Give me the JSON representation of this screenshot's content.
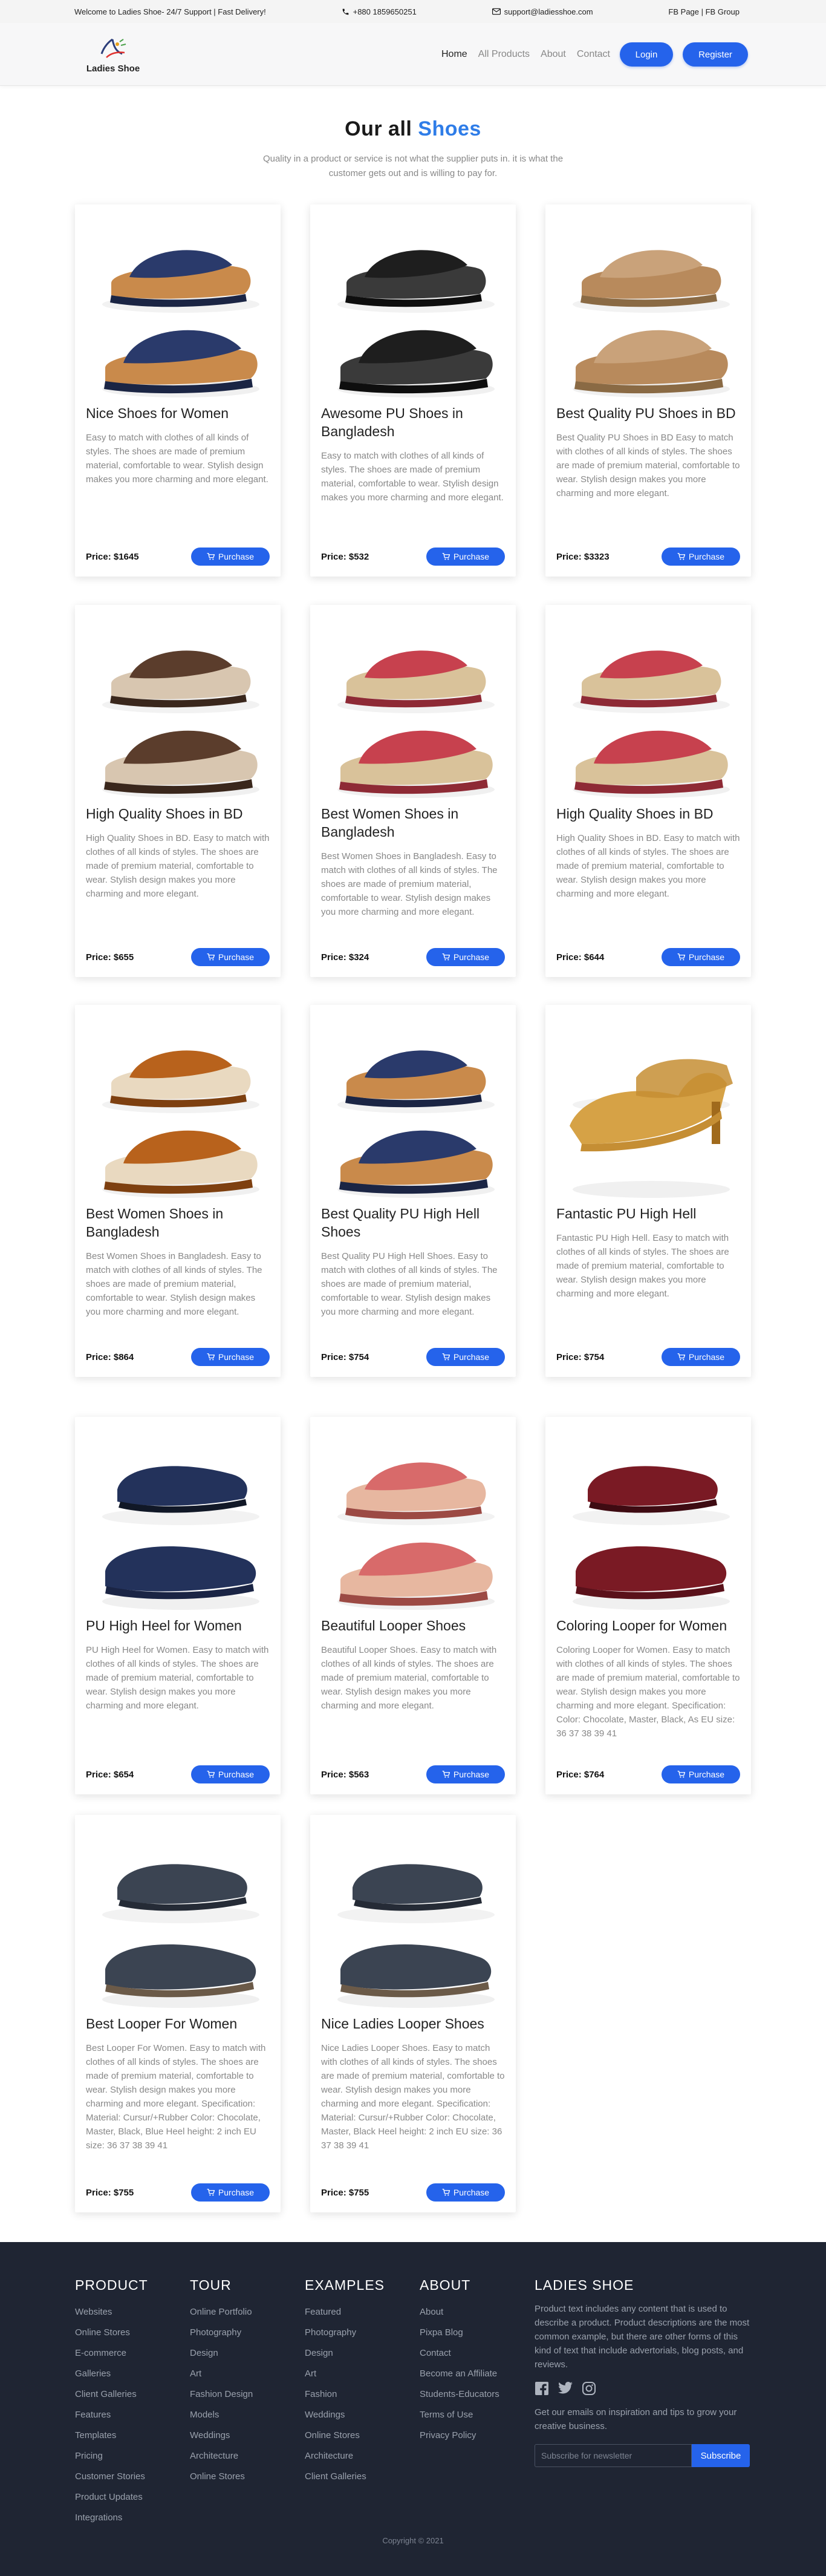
{
  "topbar": {
    "welcome": "Welcome to Ladies Shoe- 24/7 Support | Fast Delivery!",
    "phone": "+880 1859650251",
    "email": "support@ladiesshoe.com",
    "social": "FB Page | FB Group"
  },
  "nav": {
    "brand": "Ladies Shoe",
    "links": [
      "Home",
      "All Products",
      "About",
      "Contact"
    ],
    "login": "Login",
    "register": "Register"
  },
  "hero": {
    "title_a": "Our all",
    "title_b": "Shoes",
    "subtitle": "Quality in a product or service is not what the supplier puts in. it is what the customer gets out and is willing to pay for."
  },
  "purchase_label": "Purchase",
  "products": [
    {
      "title": "Nice Shoes for Women",
      "desc": "Easy to match with clothes of all kinds of styles. The shoes are made of premium material, comfortable to wear. Stylish design makes you more charming and more elegant.",
      "price": "Price: $1645",
      "kind": "sandal-navy"
    },
    {
      "title": "Awesome PU Shoes in Bangladesh",
      "desc": "Easy to match with clothes of all kinds of styles. The shoes are made of premium material, comfortable to wear. Stylish design makes you more charming and more elegant.",
      "price": "Price: $532",
      "kind": "slide-black"
    },
    {
      "title": "Best Quality PU Shoes in BD",
      "desc": "Best Quality PU Shoes in BD Easy to match with clothes of all kinds of styles. The shoes are made of premium material, comfortable to wear. Stylish design makes you more charming and more elegant.",
      "price": "Price: $3323",
      "kind": "slide-tan"
    },
    {
      "title": "High Quality Shoes in BD",
      "desc": "High Quality Shoes in BD. Easy to match with clothes of all kinds of styles. The shoes are made of premium material, comfortable to wear. Stylish design makes you more charming and more elegant.",
      "price": "Price: $655",
      "kind": "sandal-brown"
    },
    {
      "title": "Best Women Shoes in Bangladesh",
      "desc": "Best Women Shoes in Bangladesh. Easy to match with clothes of all kinds of styles. The shoes are made of premium material, comfortable to wear. Stylish design makes you more charming and more elegant.",
      "price": "Price: $324",
      "kind": "slide-red"
    },
    {
      "title": "High Quality Shoes in BD",
      "desc": "High Quality Shoes in BD. Easy to match with clothes of all kinds of styles. The shoes are made of premium material, comfortable to wear. Stylish design makes you more charming and more elegant.",
      "price": "Price: $644",
      "kind": "slide-red"
    },
    {
      "title": "Best Women Shoes in Bangladesh",
      "desc": "Best Women Shoes in Bangladesh. Easy to match with clothes of all kinds of styles. The shoes are made of premium material, comfortable to wear. Stylish design makes you more charming and more elegant.",
      "price": "Price: $864",
      "kind": "slide-orange"
    },
    {
      "title": "Best Quality PU High Hell Shoes",
      "desc": "Best Quality PU High Hell Shoes. Easy to match with clothes of all kinds of styles. The shoes are made of premium material, comfortable to wear. Stylish design makes you more charming and more elegant.",
      "price": "Price: $754",
      "kind": "sandal-navy"
    },
    {
      "title": "Fantastic PU High Hell",
      "desc": "Fantastic PU High Hell. Easy to match with clothes of all kinds of styles. The shoes are made of premium material, comfortable to wear. Stylish design makes you more charming and more elegant.",
      "price": "Price: $754",
      "kind": "heel-gold"
    },
    {
      "title": "PU High Heel for Women",
      "desc": "PU High Heel for Women. Easy to match with clothes of all kinds of styles. The shoes are made of premium material, comfortable to wear. Stylish design makes you more charming and more elegant.",
      "price": "Price: $654",
      "kind": "loafer-navy"
    },
    {
      "title": "Beautiful Looper Shoes",
      "desc": "Beautiful Looper Shoes. Easy to match with clothes of all kinds of styles. The shoes are made of premium material, comfortable to wear. Stylish design makes you more charming and more elegant.",
      "price": "Price: $563",
      "kind": "slide-pink"
    },
    {
      "title": "Coloring Looper for Women",
      "desc": "Coloring Looper for Women. Easy to match with clothes of all kinds of styles. The shoes are made of premium material, comfortable to wear. Stylish design makes you more charming and more elegant. Specification: Color: Chocolate, Master, Black, As EU size: 36 37 38 39 41",
      "price": "Price: $764",
      "kind": "flat-maroon"
    },
    {
      "title": "Best Looper For Women",
      "desc": "Best Looper For Women. Easy to match with clothes of all kinds of styles. The shoes are made of premium material, comfortable to wear. Stylish design makes you more charming and more elegant. Specification: Material: Cursur/+Rubber Color: Chocolate, Master, Black, Blue Heel height: 2 inch EU size: 36 37 38 39 41",
      "price": "Price: $755",
      "kind": "loafer-grey"
    },
    {
      "title": "Nice Ladies Looper Shoes",
      "desc": "Nice Ladies Looper Shoes. Easy to match with clothes of all kinds of styles. The shoes are made of premium material, comfortable to wear. Stylish design makes you more charming and more elegant. Specification: Material: Cursur/+Rubber Color: Chocolate, Master, Black Heel height: 2 inch EU size: 36 37 38 39 41",
      "price": "Price: $755",
      "kind": "loafer-grey"
    }
  ],
  "footer": {
    "cols": [
      {
        "title": "PRODUCT",
        "links": [
          "Websites",
          "Online Stores",
          "E-commerce",
          "Galleries",
          "Client Galleries",
          "Features",
          "Templates",
          "Pricing",
          "Customer Stories",
          "Product Updates",
          "Integrations"
        ]
      },
      {
        "title": "TOUR",
        "links": [
          "Online Portfolio",
          "Photography",
          "Design",
          "Art",
          "Fashion Design",
          "Models",
          "Weddings",
          "Architecture",
          "Online Stores"
        ]
      },
      {
        "title": "EXAMPLES",
        "links": [
          "Featured",
          "Photography",
          "Design",
          "Art",
          "Fashion",
          "Weddings",
          "Online Stores",
          "Architecture",
          "Client Galleries"
        ]
      },
      {
        "title": "ABOUT",
        "links": [
          "About",
          "Pixpa Blog",
          "Contact",
          "Become an Affiliate",
          "Students-Educators",
          "Terms of Use",
          "Privacy Policy"
        ]
      }
    ],
    "brand_title": "LADIES SHOE",
    "brand_text": "Product text includes any content that is used to describe a product. Product descriptions are the most common example, but there are other forms of this kind of text that include advertorials, blog posts, and reviews.",
    "social_icons": [
      "facebook-icon",
      "twitter-icon",
      "instagram-icon"
    ],
    "news_text": "Get our emails on inspiration and tips to grow your creative business.",
    "news_placeholder": "Subscribe for newsletter",
    "news_button": "Subscribe",
    "copyright": "Copyright © 2021"
  },
  "colors": {
    "accent": "#2563eb",
    "footer_bg": "#1f2533"
  }
}
